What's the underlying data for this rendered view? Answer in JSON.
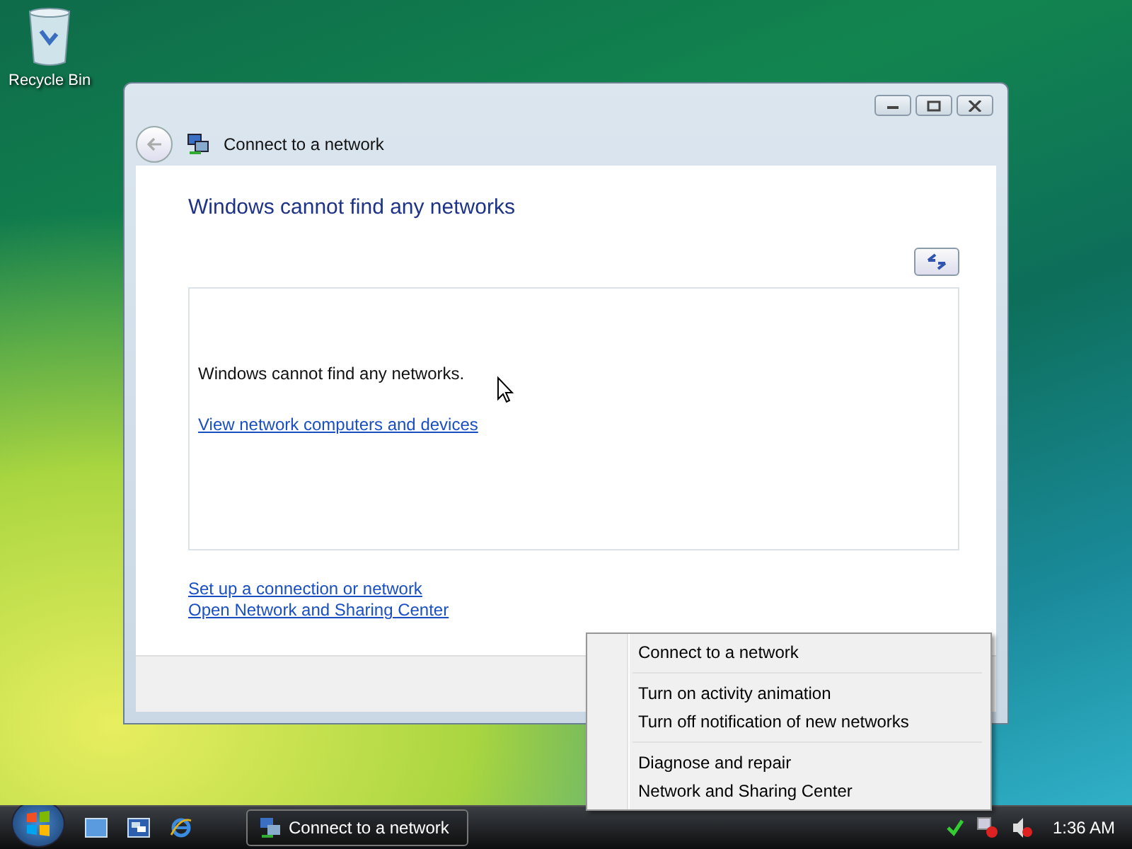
{
  "desktop": {
    "icons": [
      {
        "label": "Recycle Bin"
      }
    ]
  },
  "window": {
    "title": "Connect to a network",
    "heading": "Windows cannot find any networks",
    "message": "Windows cannot find any networks.",
    "list_link": "View network computers and devices",
    "footer_links": [
      "Set up a connection or network",
      "Open Network and Sharing Center"
    ]
  },
  "context_menu": {
    "groups": [
      [
        "Connect to a network"
      ],
      [
        "Turn on activity animation",
        "Turn off notification of new networks"
      ],
      [
        "Diagnose and repair",
        "Network and Sharing Center"
      ]
    ]
  },
  "taskbar": {
    "tasks": [
      {
        "label": "Connect to a network",
        "selected": true
      }
    ],
    "clock": "1:36 AM"
  }
}
